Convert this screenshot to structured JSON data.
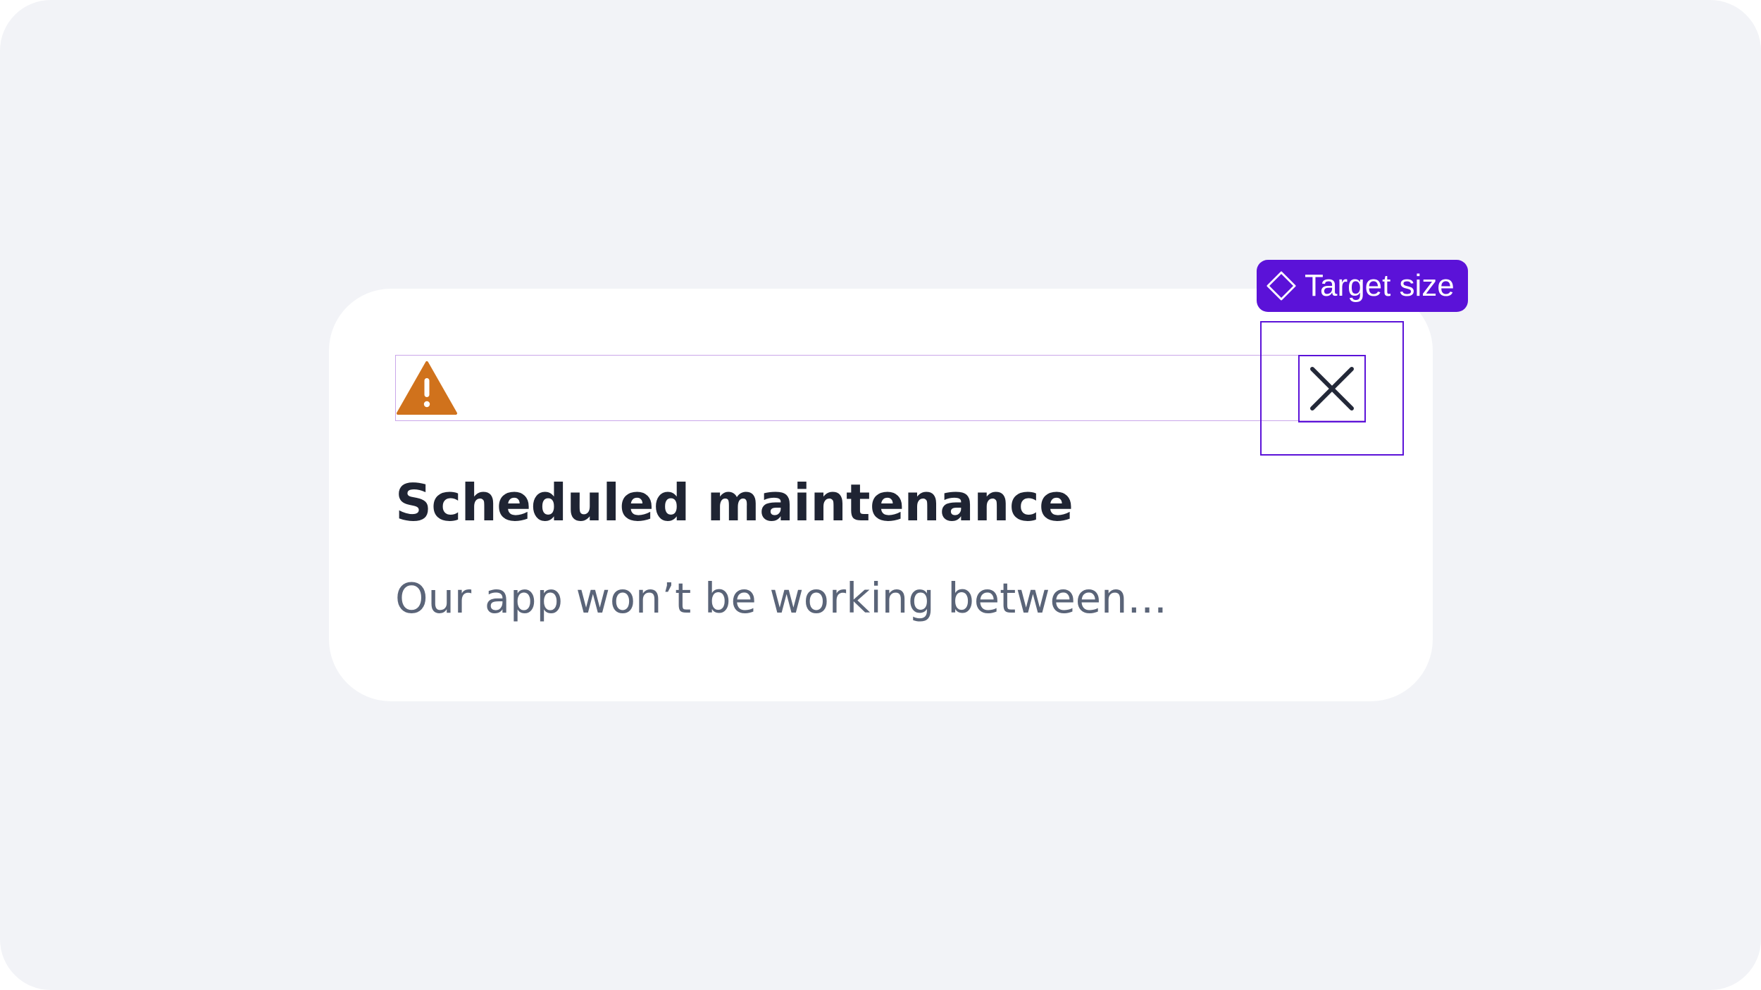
{
  "notification": {
    "title": "Scheduled maintenance",
    "body": "Our app won’t be working between..."
  },
  "annotation": {
    "badge_label": "Target size"
  },
  "icons": {
    "warning": "warning-triangle-icon",
    "close": "close-icon",
    "badge": "diamond-component-icon"
  },
  "colors": {
    "background": "#f2f3f7",
    "card": "#ffffff",
    "warning": "#d0721c",
    "title": "#1f2433",
    "body": "#5a6478",
    "annotation": "#5b12d8",
    "header_outline": "#c9a6ea"
  }
}
